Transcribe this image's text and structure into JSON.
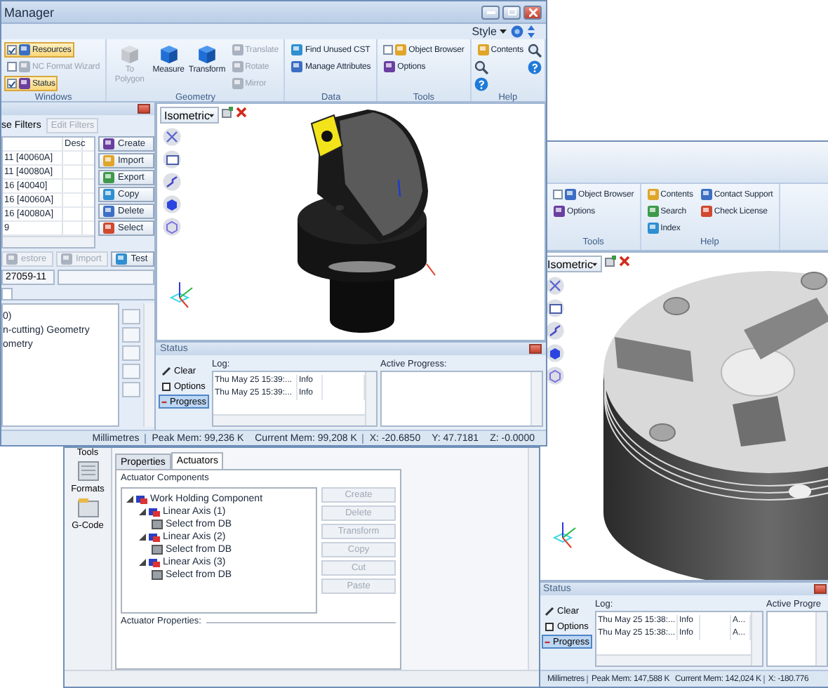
{
  "main_window": {
    "title": "Manager",
    "style_menu": "Style",
    "ribbon": [
      {
        "label": "Windows",
        "items": [
          {
            "kind": "check",
            "label": "Resources",
            "checked": true,
            "disabled": false
          },
          {
            "kind": "check",
            "label": "NC Format Wizard",
            "checked": false,
            "disabled": true
          },
          {
            "kind": "check",
            "label": "Status",
            "checked": true,
            "disabled": false
          }
        ]
      },
      {
        "label": "Geometry",
        "items": [
          {
            "kind": "large",
            "label": "To Polygon",
            "disabled": true
          },
          {
            "kind": "large",
            "label": "Measure",
            "disabled": false
          },
          {
            "kind": "large",
            "label": "Transform",
            "disabled": false
          },
          {
            "kind": "small",
            "label": "Translate",
            "disabled": true
          },
          {
            "kind": "small",
            "label": "Rotate",
            "disabled": true
          },
          {
            "kind": "small",
            "label": "Mirror",
            "disabled": true
          }
        ]
      },
      {
        "label": "Data",
        "items": [
          {
            "kind": "small",
            "label": "Find Unused CST",
            "disabled": false
          },
          {
            "kind": "small",
            "label": "Manage Attributes",
            "disabled": false
          }
        ]
      },
      {
        "label": "Tools",
        "items": [
          {
            "kind": "check",
            "label": "Object Browser",
            "checked": false,
            "disabled": false
          },
          {
            "kind": "small",
            "label": "Options",
            "disabled": false
          }
        ]
      },
      {
        "label": "Help",
        "items": [
          {
            "kind": "small",
            "label": "Contents",
            "disabled": false
          },
          {
            "kind": "search"
          },
          {
            "kind": "help"
          },
          {
            "kind": "search"
          },
          {
            "kind": "help"
          }
        ]
      }
    ],
    "resources": {
      "filter_tab": "se Filters",
      "edit_filters": {
        "label": "Edit Filters",
        "disabled": true
      },
      "column": "Desc",
      "rows": [
        "11 [40060A]",
        "11 [40080A]",
        "16 [40040]",
        "16 [40060A]",
        "16 [40080A]",
        "9"
      ],
      "actions": [
        "Create",
        "Import",
        "Export",
        "Copy",
        "Delete",
        "Select"
      ],
      "lower_actions": [
        {
          "label": "estore",
          "disabled": true
        },
        {
          "label": "Import",
          "disabled": true
        },
        {
          "label": "Test",
          "disabled": false
        }
      ],
      "code_field": "27059-11",
      "tree": [
        "0)",
        "n-cutting) Geometry",
        "ometry"
      ]
    },
    "viewport": {
      "view": "Isometric"
    },
    "status": {
      "title": "Status",
      "actions": [
        {
          "label": "Clear",
          "selected": false
        },
        {
          "label": "Options",
          "selected": false
        },
        {
          "label": "Progress",
          "selected": true
        }
      ],
      "log_label": "Log:",
      "log": [
        {
          "time": "Thu May 25 15:39:...",
          "level": "Info"
        },
        {
          "time": "Thu May 25 15:39:...",
          "level": "Info"
        }
      ],
      "progress_label": "Active Progress:"
    },
    "status_bar": [
      {
        "text": "Millimetres",
        "divider": true
      },
      {
        "text": "Peak Mem: 99,236 K",
        "divider": false
      },
      {
        "text": "Current Mem: 99,208 K",
        "divider": true
      },
      {
        "text": "X:  -20.6850",
        "divider": false
      },
      {
        "text": "Y:  47.7181",
        "divider": false
      },
      {
        "text": "Z:  -0.0000",
        "divider": false
      }
    ]
  },
  "actuator_window": {
    "sidebar": [
      "Tools",
      "Formats",
      "G-Code"
    ],
    "tabs": [
      {
        "label": "Properties",
        "selected": false
      },
      {
        "label": "Actuators",
        "selected": true
      }
    ],
    "components_label": "Actuator Components",
    "tree": [
      {
        "label": "Work Holding Component",
        "expanded": true,
        "children": [
          {
            "label": "Linear Axis (1)",
            "expanded": true,
            "children": [
              {
                "label": "Select from DB"
              }
            ]
          },
          {
            "label": "Linear Axis (2)",
            "expanded": true,
            "children": [
              {
                "label": "Select from DB"
              }
            ]
          },
          {
            "label": "Linear Axis (3)",
            "expanded": true,
            "children": [
              {
                "label": "Select from DB"
              }
            ]
          }
        ]
      }
    ],
    "buttons": [
      {
        "label": "Create",
        "disabled": true
      },
      {
        "label": "Delete",
        "disabled": true
      },
      {
        "label": "Transform",
        "disabled": true
      },
      {
        "label": "Copy",
        "disabled": true
      },
      {
        "label": "Cut",
        "disabled": true
      },
      {
        "label": "Paste",
        "disabled": true
      }
    ],
    "properties_label": "Actuator Properties:"
  },
  "second_window": {
    "ribbon": [
      {
        "label": "Tools",
        "items": [
          {
            "kind": "check",
            "label": "Object Browser",
            "checked": false,
            "disabled": false
          },
          {
            "kind": "small",
            "label": "Options",
            "disabled": false
          }
        ]
      },
      {
        "label": "Help",
        "items": [
          {
            "kind": "small",
            "label": "Contents",
            "disabled": false
          },
          {
            "kind": "small",
            "label": "Search",
            "disabled": false
          },
          {
            "kind": "small",
            "label": "Index",
            "disabled": false
          },
          {
            "kind": "small",
            "label": "Contact Support",
            "disabled": false
          },
          {
            "kind": "small",
            "label": "Check License",
            "disabled": false
          }
        ]
      }
    ],
    "viewport": {
      "view": "Isometric"
    },
    "status": {
      "title": "Status",
      "actions": [
        {
          "label": "Clear",
          "selected": false
        },
        {
          "label": "Options",
          "selected": false
        },
        {
          "label": "Progress",
          "selected": true
        }
      ],
      "log_label": "Log:",
      "log": [
        {
          "time": "Thu May 25 15:38:...",
          "level": "Info",
          "extra": "A..."
        },
        {
          "time": "Thu May 25 15:38:...",
          "level": "Info",
          "extra": "A..."
        }
      ],
      "progress_label": "Active Progre"
    },
    "status_bar": [
      {
        "text": "Millimetres",
        "divider": true
      },
      {
        "text": "Peak Mem: 147,588 K",
        "divider": false
      },
      {
        "text": "Current Mem: 142,024 K",
        "divider": true
      },
      {
        "text": "X:  -180.776",
        "divider": false
      }
    ]
  }
}
